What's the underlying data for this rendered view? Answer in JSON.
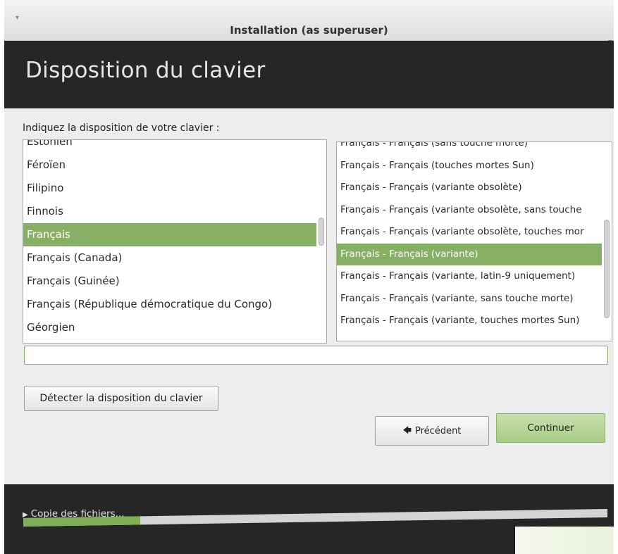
{
  "window": {
    "title": "Installation (as superuser)",
    "minimize_glyph": "_",
    "menu_glyph": "▾"
  },
  "header": {
    "title": "Disposition du clavier"
  },
  "prompt": "Indiquez la disposition de votre clavier :",
  "layouts": {
    "items": [
      "Estonien",
      "Féroïen",
      "Filipino",
      "Finnois",
      "Français",
      "Français (Canada)",
      "Français (Guinée)",
      "Français (République démocratique du Congo)",
      "Géorgien"
    ],
    "selected": "Français"
  },
  "variants": {
    "items": [
      "Français - Français (sans touche morte)",
      "Français - Français (touches mortes Sun)",
      "Français - Français (variante obsolète)",
      "Français - Français (variante obsolète, sans touche",
      "Français - Français (variante obsolète, touches mor",
      "Français - Français (variante)",
      "Français - Français (variante, latin-9 uniquement)",
      "Français - Français (variante, sans touche morte)",
      "Français - Français (variante, touches mortes Sun)"
    ],
    "selected": "Français - Français (variante)"
  },
  "test_input": {
    "value": "",
    "placeholder": ""
  },
  "buttons": {
    "detect": "Détecter la disposition du clavier",
    "back": "Précédent",
    "back_icon": "back-arrow-icon",
    "continue": "Continuer"
  },
  "progress": {
    "label": "Copie des fichiers...",
    "fraction": 0.2
  },
  "colors": {
    "accent": "#88b065",
    "header_bg": "#262626",
    "continue_bg": "#a9cc85"
  }
}
